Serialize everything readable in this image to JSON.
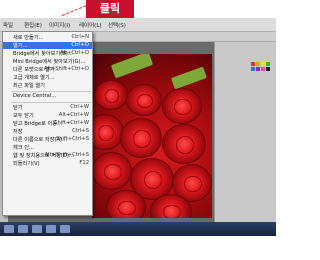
{
  "callout": {
    "text": "클릭"
  },
  "menubar": {
    "items": [
      "파일",
      "편집(E)",
      "이미지(I)",
      "레이어(L)",
      "선택(S)"
    ]
  },
  "file_menu": {
    "items": [
      {
        "label": "새로 만들기...",
        "shortcut": "Ctrl+N"
      },
      {
        "label": "열기...",
        "shortcut": "Ctrl+O",
        "selected": true
      },
      {
        "label": "Bridge에서 찾아보기(B)...",
        "shortcut": "Alt+Ctrl+O"
      },
      {
        "label": "Mini Bridge에서 찾아보기(G)...",
        "shortcut": ""
      },
      {
        "label": "다른 포맷으로 열기...",
        "shortcut": "Alt+Shift+Ctrl+O"
      },
      {
        "label": "고급 개체로 열기...",
        "shortcut": ""
      },
      {
        "label": "최근 파일 열기",
        "shortcut": ""
      },
      {
        "label": "Device Central...",
        "shortcut": ""
      },
      {
        "label": "닫기",
        "shortcut": "Ctrl+W"
      },
      {
        "label": "모두 닫기",
        "shortcut": "Alt+Ctrl+W"
      },
      {
        "label": "닫고 Bridge로 이동...",
        "shortcut": "Shift+Ctrl+W"
      },
      {
        "label": "저장",
        "shortcut": "Ctrl+S"
      },
      {
        "label": "다른 이름으로 저장(A)...",
        "shortcut": "Shift+Ctrl+S"
      },
      {
        "label": "체크 인...",
        "shortcut": ""
      },
      {
        "label": "웹 및 장치용으로 저장(D)...",
        "shortcut": "Alt+Shift+Ctrl+S"
      },
      {
        "label": "되돌리기(V)",
        "shortcut": "F12"
      }
    ]
  },
  "colors": {
    "callout": "#c8102e",
    "menu_highlight": "#3874d8",
    "taskbar": "#1f2d4f"
  }
}
